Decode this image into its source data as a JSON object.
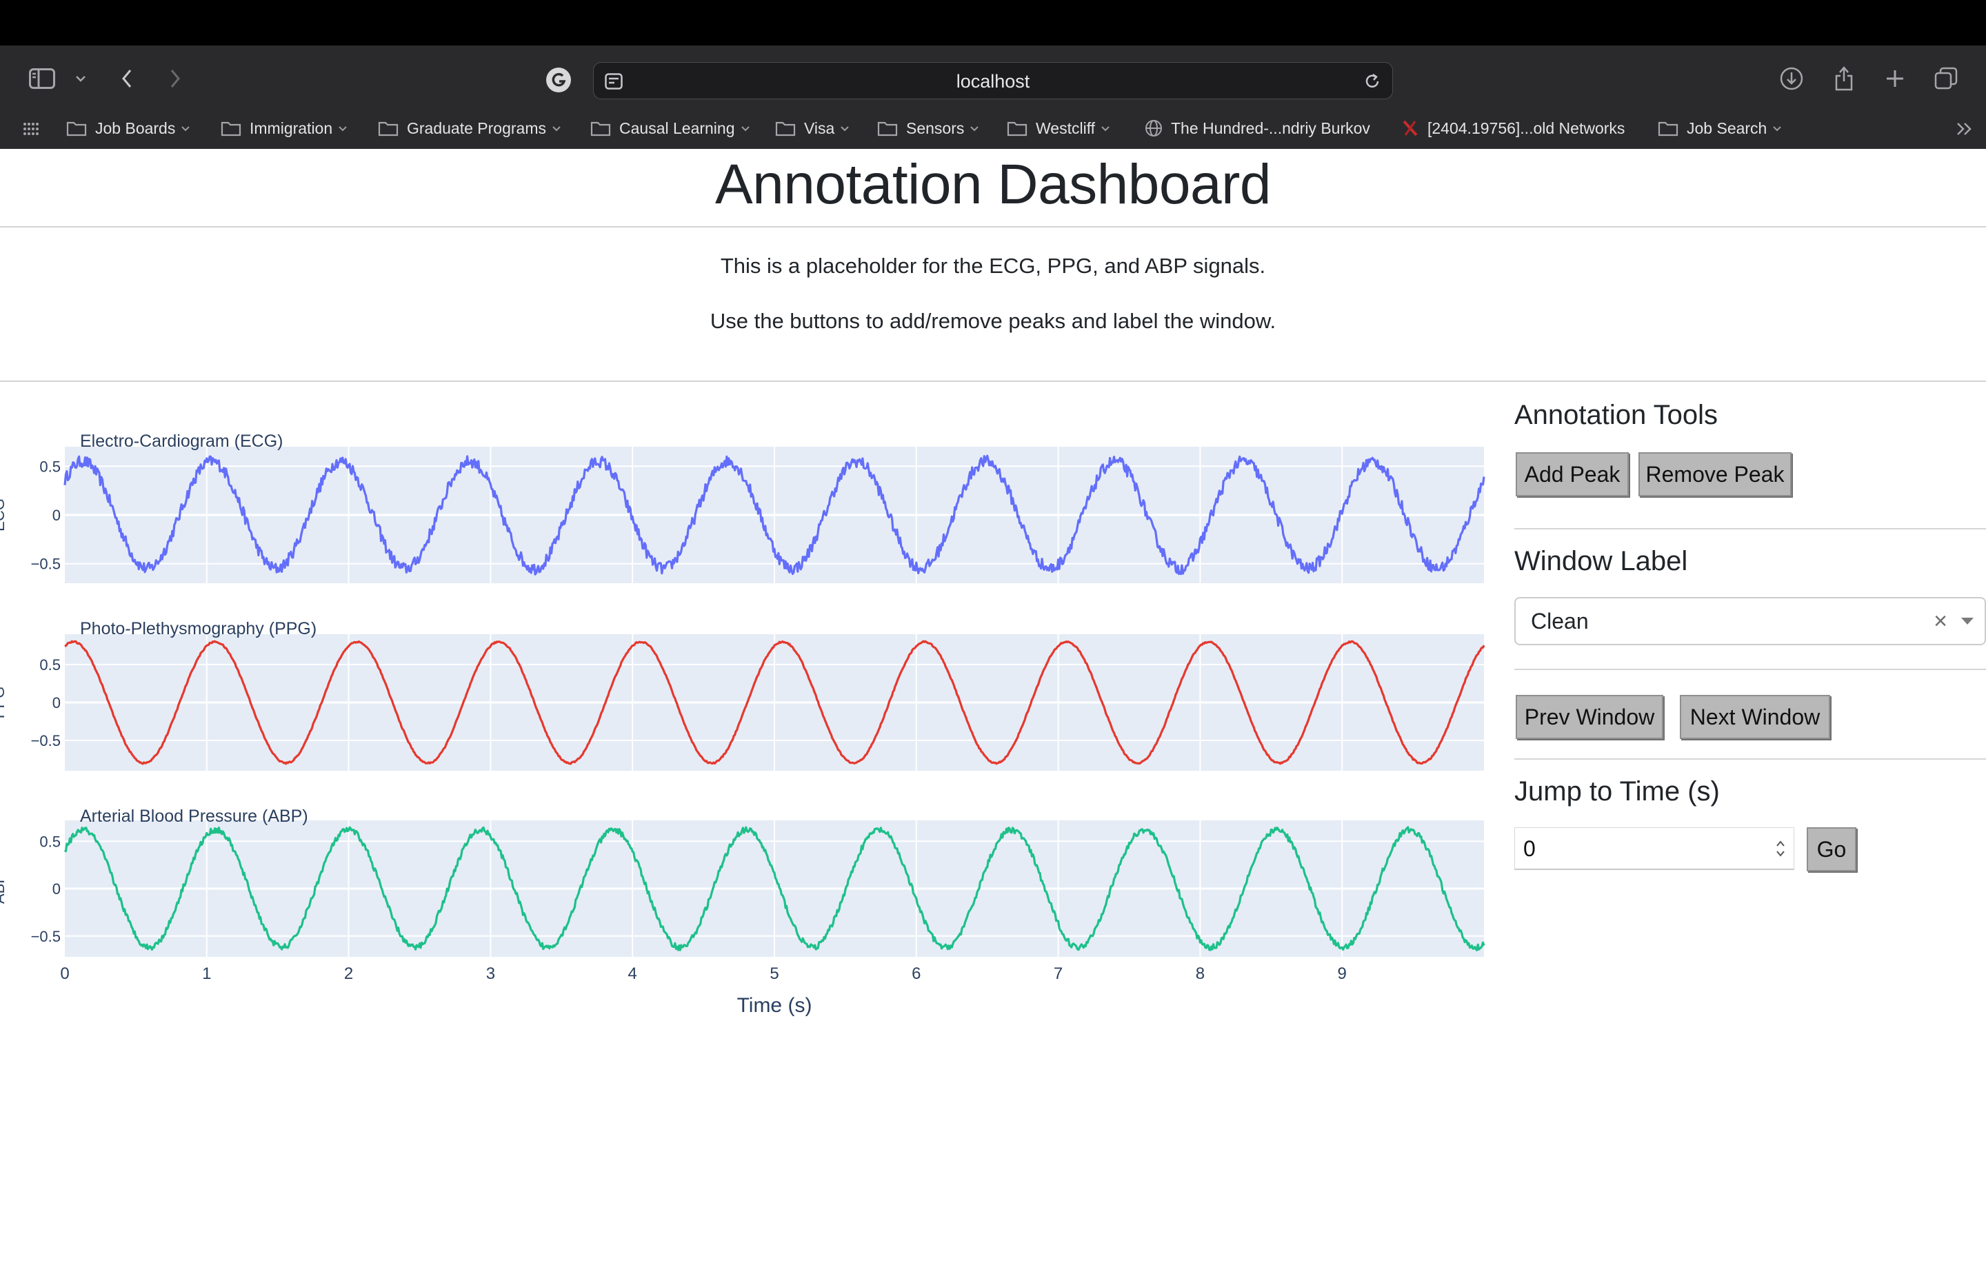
{
  "browser": {
    "url": "localhost",
    "bookmarks": [
      {
        "label": "Job Boards",
        "icon": "folder-icon",
        "has_menu": true
      },
      {
        "label": "Immigration",
        "icon": "folder-icon",
        "has_menu": true
      },
      {
        "label": "Graduate Programs",
        "icon": "folder-icon",
        "has_menu": true
      },
      {
        "label": "Causal Learning",
        "icon": "folder-icon",
        "has_menu": true
      },
      {
        "label": "Visa",
        "icon": "folder-icon",
        "has_menu": true
      },
      {
        "label": "Sensors",
        "icon": "folder-icon",
        "has_menu": true
      },
      {
        "label": "Westcliff",
        "icon": "folder-icon",
        "has_menu": true
      },
      {
        "label": "The Hundred-...ndriy Burkov",
        "icon": "globe-icon",
        "has_menu": false
      },
      {
        "label": "[2404.19756]...old Networks",
        "icon": "arxiv-icon",
        "has_menu": false
      },
      {
        "label": "Job Search",
        "icon": "folder-icon",
        "has_menu": true
      }
    ]
  },
  "page": {
    "title": "Annotation Dashboard",
    "intro_line1": "This is a placeholder for the ECG, PPG, and ABP signals.",
    "intro_line2": "Use the buttons to add/remove peaks and label the window."
  },
  "panel": {
    "tools_heading": "Annotation Tools",
    "add_peak": "Add Peak",
    "remove_peak": "Remove Peak",
    "window_label_heading": "Window Label",
    "window_label_value": "Clean",
    "clear_symbol": "×",
    "prev_window": "Prev Window",
    "next_window": "Next Window",
    "jump_heading": "Jump to Time (s)",
    "jump_value": "0",
    "go": "Go"
  },
  "chart_data": [
    {
      "type": "line",
      "title": "Electro-Cardiogram (ECG)",
      "ylabel": "ECG",
      "color": "#636efa",
      "frequency_hz": 1.1,
      "amplitude": 0.55,
      "x_range": [
        0,
        10
      ],
      "ylim": [
        -0.7,
        0.7
      ],
      "y_ticks": [
        "0.5",
        "0",
        "−0.5"
      ],
      "y_tick_values": [
        0.5,
        0,
        -0.5
      ],
      "noise": "high"
    },
    {
      "type": "line",
      "title": "Photo-Plethysmography (PPG)",
      "ylabel": "PPG",
      "color": "#e5392f",
      "frequency_hz": 1.0,
      "amplitude": 0.8,
      "x_range": [
        0,
        10
      ],
      "ylim": [
        -0.9,
        0.9
      ],
      "y_ticks": [
        "0.5",
        "0",
        "−0.5"
      ],
      "y_tick_values": [
        0.5,
        0,
        -0.5
      ],
      "noise": "low"
    },
    {
      "type": "line",
      "title": "Arterial Blood Pressure (ABP)",
      "ylabel": "ABP",
      "color": "#1ec08a",
      "frequency_hz": 1.07,
      "amplitude": 0.62,
      "x_range": [
        0,
        10
      ],
      "ylim": [
        -0.72,
        0.72
      ],
      "y_ticks": [
        "0.5",
        "0",
        "−0.5"
      ],
      "y_tick_values": [
        0.5,
        0,
        -0.5
      ],
      "noise": "medium",
      "x_ticks": [
        "0",
        "1",
        "2",
        "3",
        "4",
        "5",
        "6",
        "7",
        "8",
        "9"
      ],
      "x_tick_values": [
        0,
        1,
        2,
        3,
        4,
        5,
        6,
        7,
        8,
        9
      ],
      "xlabel": "Time (s)"
    }
  ]
}
